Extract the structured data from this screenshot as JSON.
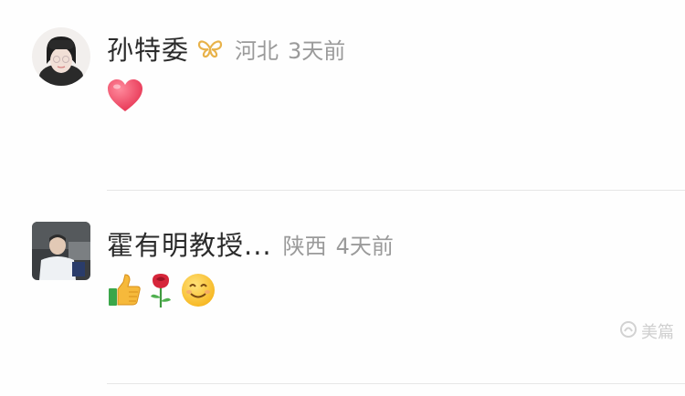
{
  "comments": [
    {
      "name": "孙特委",
      "location": "河北",
      "time": "3天前",
      "emoji_icons": [
        "heart-icon"
      ]
    },
    {
      "name": "霍有明教授...",
      "location": "陕西",
      "time": "4天前",
      "emoji_icons": [
        "thumbs-up-icon",
        "rose-icon",
        "smile-icon"
      ]
    }
  ],
  "watermark": {
    "text": "美篇",
    "icon": "meipian-logo-icon"
  },
  "colors": {
    "name": "#2b2b2b",
    "meta": "#9a9a9a",
    "divider": "#e6e6e6",
    "badge": "#e8b24a",
    "heart": "#f0506a"
  }
}
